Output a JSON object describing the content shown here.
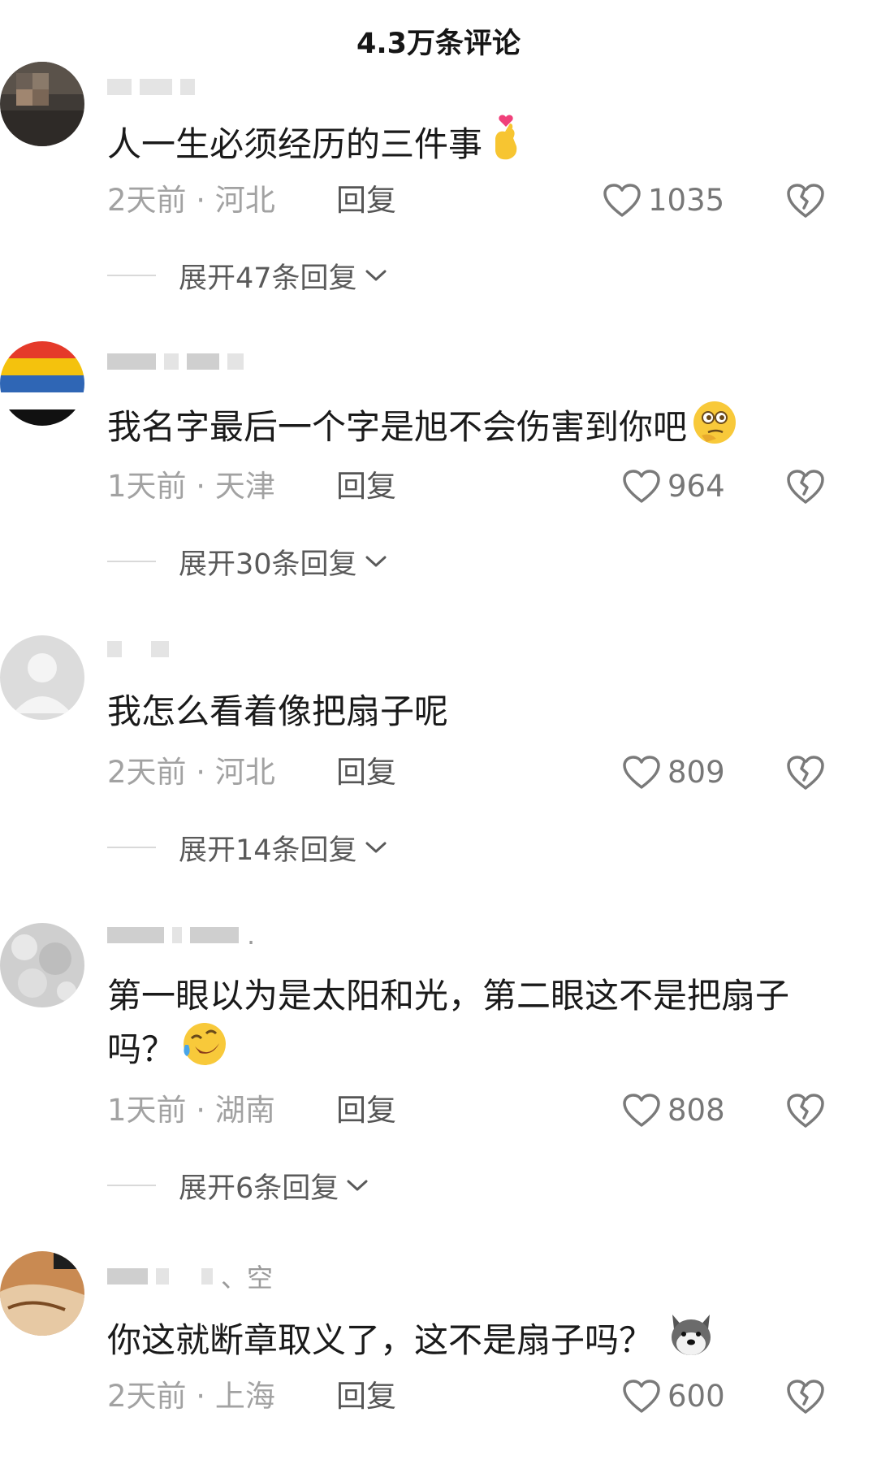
{
  "header": {
    "title": "4.3万条评论"
  },
  "comments": [
    {
      "text": "人一生必须经历的三件事",
      "emoji": "finger-heart-emoji",
      "time_location": "2天前 · 河北",
      "reply_label": "回复",
      "likes": "1035",
      "expand_label": "展开47条回复"
    },
    {
      "text": "我名字最后一个字是旭不会伤害到你吧",
      "emoji": "thinking-face-emoji",
      "time_location": "1天前 · 天津",
      "reply_label": "回复",
      "likes": "964",
      "expand_label": "展开30条回复"
    },
    {
      "text": "我怎么看着像把扇子呢",
      "emoji": "",
      "time_location": "2天前 · 河北",
      "reply_label": "回复",
      "likes": "809",
      "expand_label": "展开14条回复"
    },
    {
      "username_tail": ".",
      "text": "第一眼以为是太阳和光，第二眼这不是把扇子吗？",
      "emoji": "rolling-laughing-emoji",
      "time_location": "1天前 · 湖南",
      "reply_label": "回复",
      "likes": "808",
      "expand_label": "展开6条回复"
    },
    {
      "username_tail": "、空",
      "text": "你这就断章取义了，这不是扇子吗？",
      "emoji": "husky-dog-emoji",
      "time_location": "2天前 · 上海",
      "reply_label": "回复",
      "likes": "600",
      "expand_label": ""
    }
  ]
}
